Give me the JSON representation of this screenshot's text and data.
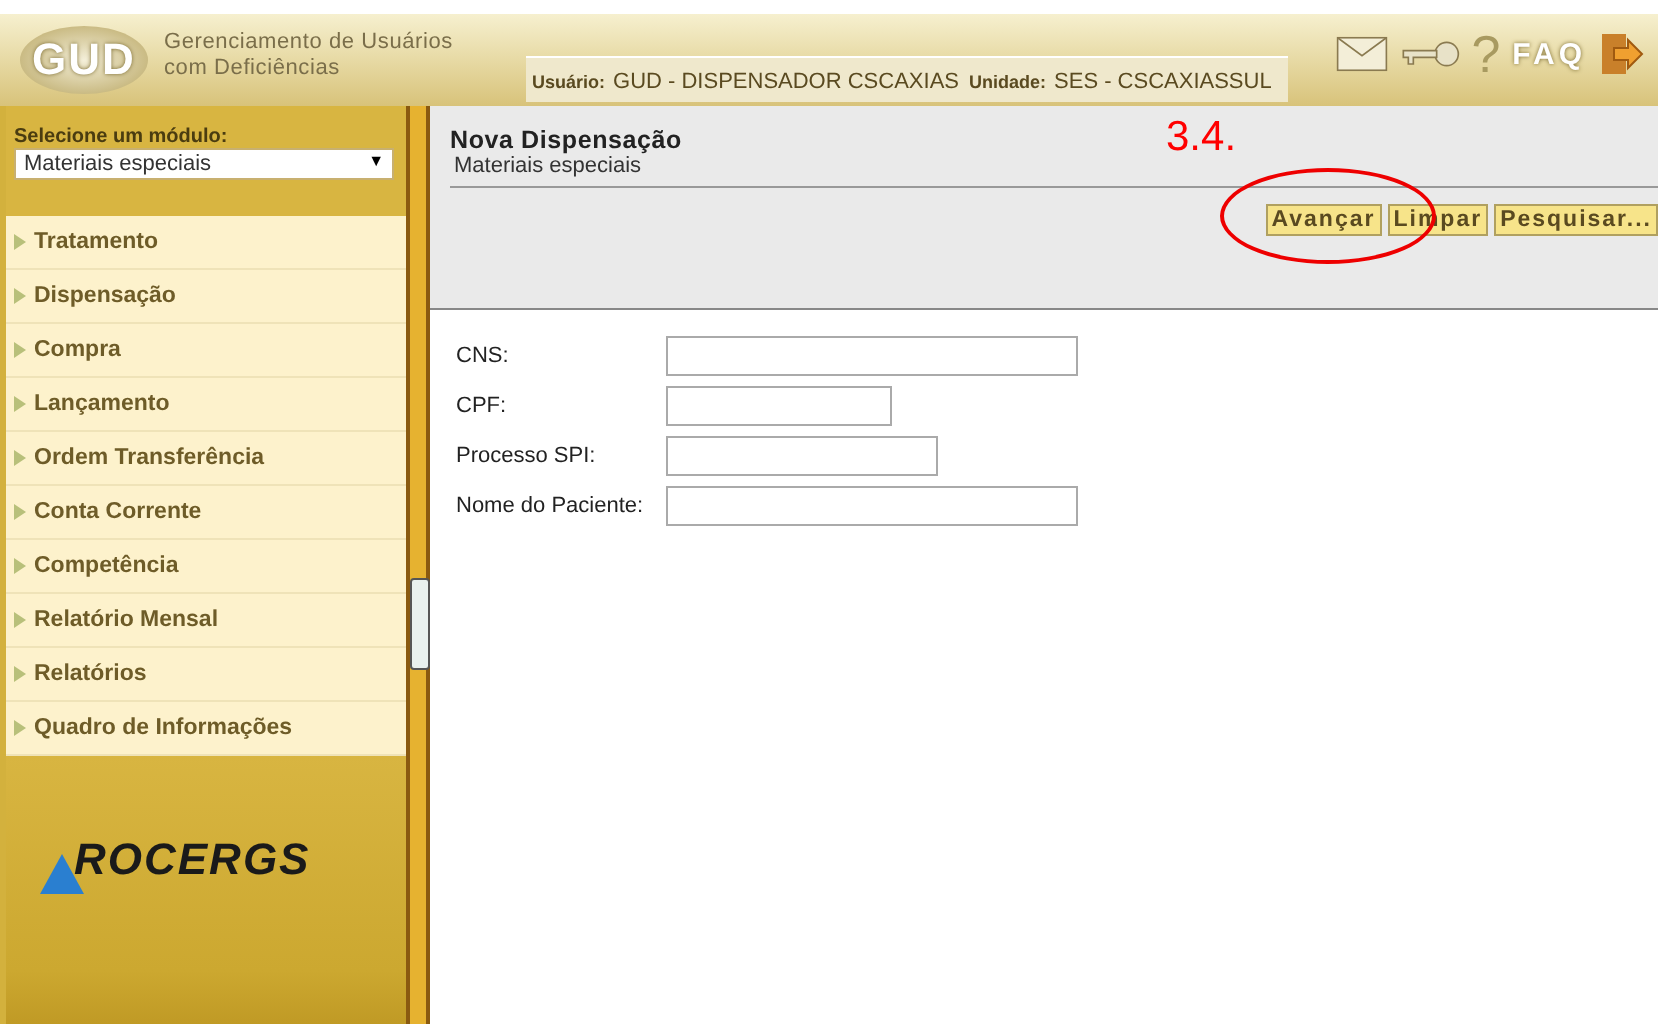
{
  "header": {
    "logo": "GUD",
    "app_name": [
      "Gerenciamento de Usuários",
      "com Deficiências"
    ],
    "user_label": "Usuário:",
    "user_value": "GUD - DISPENSADOR CSCAXIAS",
    "unit_label": "Unidade:",
    "unit_value": "SES - CSCAXIASSUL",
    "help": "?",
    "faq": "FAQ"
  },
  "sidebar": {
    "select_label": "Selecione um módulo:",
    "select_value": "Materiais especiais",
    "select_caret": "▼",
    "items": [
      {
        "label": "Tratamento"
      },
      {
        "label": "Dispensação"
      },
      {
        "label": "Compra"
      },
      {
        "label": "Lançamento"
      },
      {
        "label": "Ordem Transferência"
      },
      {
        "label": "Conta Corrente"
      },
      {
        "label": "Competência"
      },
      {
        "label": "Relatório Mensal"
      },
      {
        "label": "Relatórios"
      },
      {
        "label": "Quadro de Informações"
      }
    ],
    "footer_logo": "ROCERGS"
  },
  "panel": {
    "title": "Nova Dispensação",
    "subtitle": "Materiais especiais",
    "annotation": "3.4.",
    "buttons": [
      "Avançar",
      "Limpar",
      "Pesquisar..."
    ]
  },
  "form": {
    "fields": [
      {
        "label": "CNS:"
      },
      {
        "label": "CPF:"
      },
      {
        "label": "Processo SPI:"
      },
      {
        "label": "Nome do Paciente:"
      }
    ]
  }
}
